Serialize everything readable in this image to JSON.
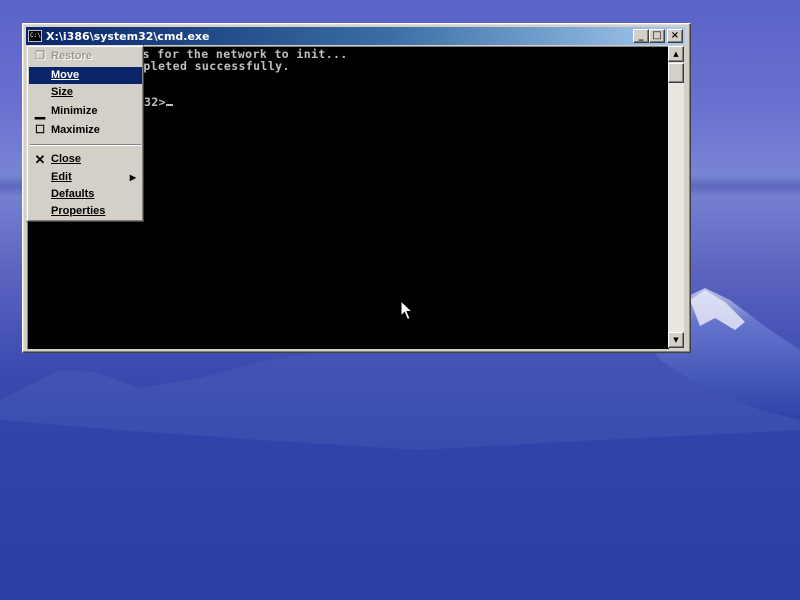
{
  "window": {
    "title": "X:\\i386\\system32\\cmd.exe",
    "icon_text": "C:\\",
    "buttons": {
      "minimize": "_",
      "maximize": "□",
      "close": "×"
    }
  },
  "console": {
    "lines": [
      "  ...nds for the network to init...",
      "  ...mpleted successfully.",
      "",
      "  ...32>"
    ],
    "visible_fragments": [
      "nds for the network to init...",
      "mpleted successfully.",
      "32>"
    ]
  },
  "system_menu": {
    "items": [
      {
        "label": "Restore",
        "glyph": "restore-icon",
        "enabled": false,
        "selected": false
      },
      {
        "label": "Move",
        "glyph": "",
        "enabled": true,
        "selected": true
      },
      {
        "label": "Size",
        "glyph": "",
        "enabled": true,
        "selected": false
      },
      {
        "label": "Minimize",
        "glyph": "minimize-icon",
        "enabled": true,
        "selected": false
      },
      {
        "label": "Maximize",
        "glyph": "maximize-icon",
        "enabled": true,
        "selected": false
      },
      {
        "label": "Close",
        "glyph": "close-icon",
        "enabled": true,
        "selected": false
      },
      {
        "label": "Edit",
        "glyph": "",
        "enabled": true,
        "selected": false,
        "submenu": true
      },
      {
        "label": "Defaults",
        "glyph": "",
        "enabled": true,
        "selected": false
      },
      {
        "label": "Properties",
        "glyph": "",
        "enabled": true,
        "selected": false
      }
    ]
  },
  "colors": {
    "titlebar_start": "#0a246a",
    "titlebar_end": "#a6caf0",
    "menu_highlight": "#0a246a",
    "console_bg": "#000000",
    "console_text": "#c0c0c0"
  }
}
